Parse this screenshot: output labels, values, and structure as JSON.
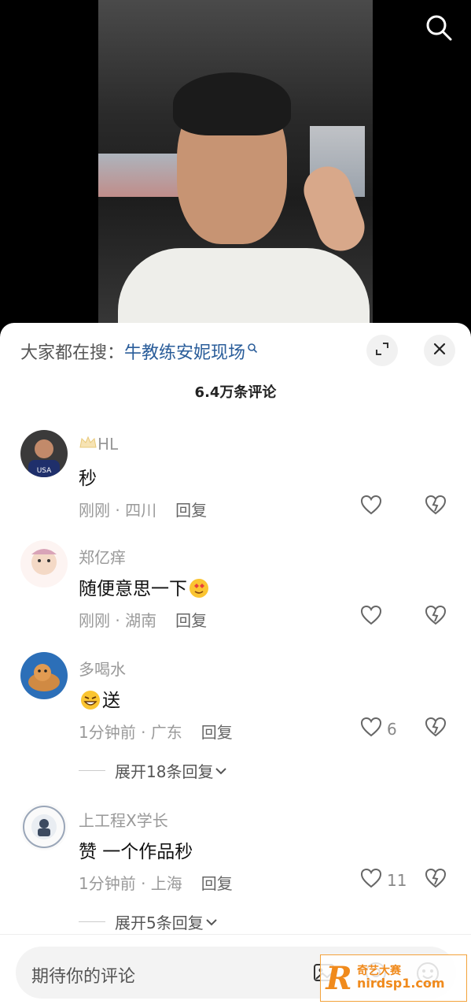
{
  "header": {
    "suggest_prefix": "大家都在搜：",
    "suggest_term": "牛教练安妮现场",
    "comment_count": "6.4万条评论"
  },
  "comments": [
    {
      "user": "HL",
      "text": "秒",
      "time_loc": "刚刚 · 四川",
      "reply": "回复",
      "likes": ""
    },
    {
      "user": "郑亿痒",
      "text": "随便意思一下",
      "time_loc": "刚刚 · 湖南",
      "reply": "回复",
      "likes": ""
    },
    {
      "user": "多喝水",
      "text": "送",
      "time_loc": "1分钟前 · 广东",
      "reply": "回复",
      "likes": "6",
      "expand": "展开18条回复"
    },
    {
      "user": "上工程X学长",
      "text": "赞 一个作品秒",
      "time_loc": "1分钟前 · 上海",
      "reply": "回复",
      "likes": "11",
      "expand": "展开5条回复"
    }
  ],
  "input": {
    "placeholder": "期待你的评论"
  },
  "watermark": {
    "top": "奇艺大赛",
    "bottom": "nirdsp1.com"
  },
  "colors": {
    "link": "#2a5d9a",
    "muted": "#9a9a9a",
    "accent": "#f08a1c"
  },
  "icons": [
    "search-icon",
    "expand-icon",
    "close-icon",
    "heart-icon",
    "broken-heart-icon",
    "image-icon",
    "at-icon",
    "emoji-icon",
    "crown-icon"
  ]
}
